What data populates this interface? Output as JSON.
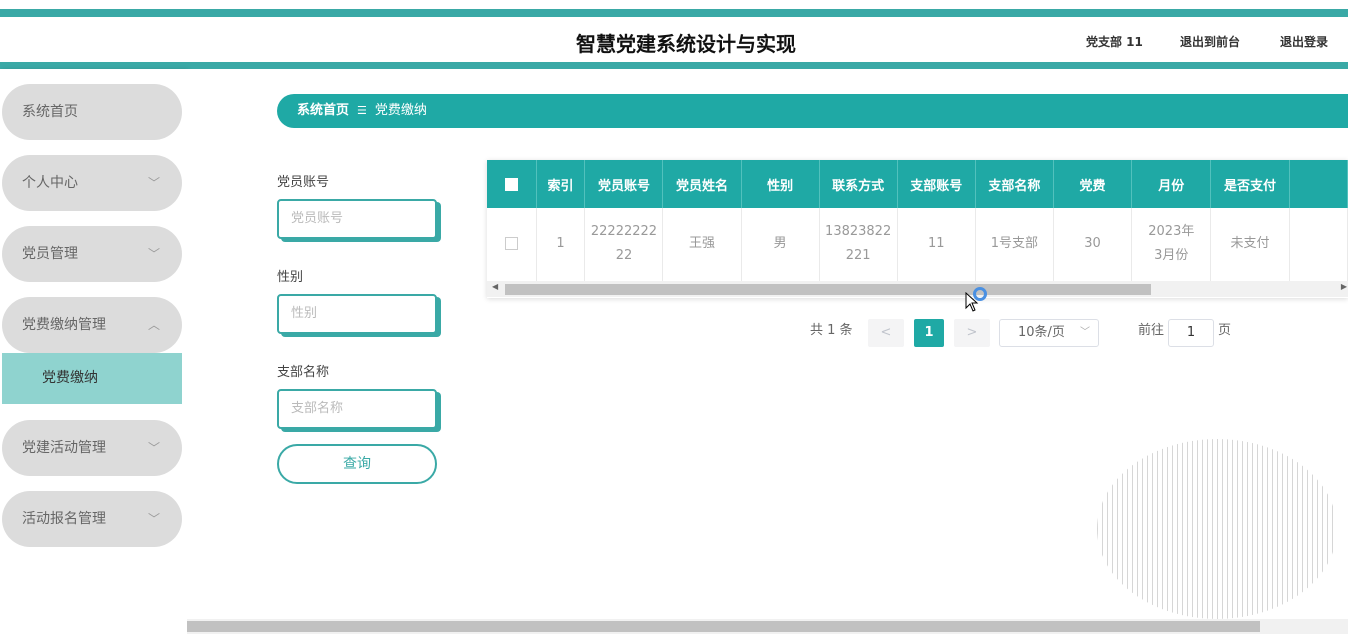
{
  "header": {
    "title": "智慧党建系统设计与实现",
    "user": "党支部 11",
    "to_front": "退出到前台",
    "logout": "退出登录"
  },
  "sidebar": {
    "items": [
      {
        "label": "系统首页"
      },
      {
        "label": "个人中心"
      },
      {
        "label": "党员管理"
      },
      {
        "label": "党费缴纳管理"
      },
      {
        "label": "党建活动管理"
      },
      {
        "label": "活动报名管理"
      }
    ],
    "submenu_label": "党费缴纳"
  },
  "breadcrumb": {
    "home": "系统首页",
    "separator": "☰",
    "current": "党费缴纳"
  },
  "filters": {
    "account_label": "党员账号",
    "account_placeholder": "党员账号",
    "gender_label": "性别",
    "gender_placeholder": "性别",
    "branch_label": "支部名称",
    "branch_placeholder": "支部名称",
    "query_button": "查询"
  },
  "table": {
    "headers": [
      "索引",
      "党员账号",
      "党员姓名",
      "性别",
      "联系方式",
      "支部账号",
      "支部名称",
      "党费",
      "月份",
      "是否支付"
    ],
    "rows": [
      [
        "1",
        "2222222222",
        "王强",
        "男",
        "13823822221",
        "11",
        "1号支部",
        "30",
        "2023年3月份",
        "未支付"
      ]
    ]
  },
  "pagination": {
    "total": "共 1 条",
    "prev": "<",
    "current": "1",
    "next": ">",
    "page_size": "10条/页",
    "goto_prefix": "前往",
    "goto_value": "1",
    "goto_suffix": "页"
  },
  "colors": {
    "accent": "#1fa9a5",
    "stripe": "#3aa9a6",
    "submenu_active": "#8fd3cf"
  }
}
